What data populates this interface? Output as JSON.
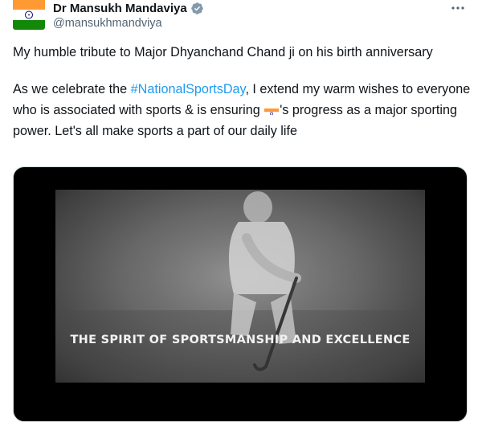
{
  "author": {
    "display_name": "Dr Mansukh Mandaviya",
    "handle": "@mansukhmandviya",
    "avatar_icon": "india-flag-avatar",
    "verified_icon": "verified-badge-icon"
  },
  "menu": {
    "icon": "more-options-icon"
  },
  "tweet": {
    "line1": "My humble tribute to Major Dhyanchand Chand ji on his birth anniversary",
    "para2_prefix": "As we celebrate the ",
    "hashtag": "#NationalSportsDay",
    "para2_mid": ", I extend my warm wishes to everyone who is associated with sports & is ensuring ",
    "flag_emoji_icon": "india-flag-emoji",
    "para2_suffix": "'s progress as a major sporting power. Let's all make sports a part of our daily life"
  },
  "media": {
    "caption": "THE SPIRIT OF SPORTSMANSHIP AND EXCELLENCE"
  },
  "colors": {
    "link": "#1d9bf0",
    "verified": "#829aab",
    "saffron": "#ff9933",
    "green": "#138808",
    "chakra": "#000080"
  }
}
